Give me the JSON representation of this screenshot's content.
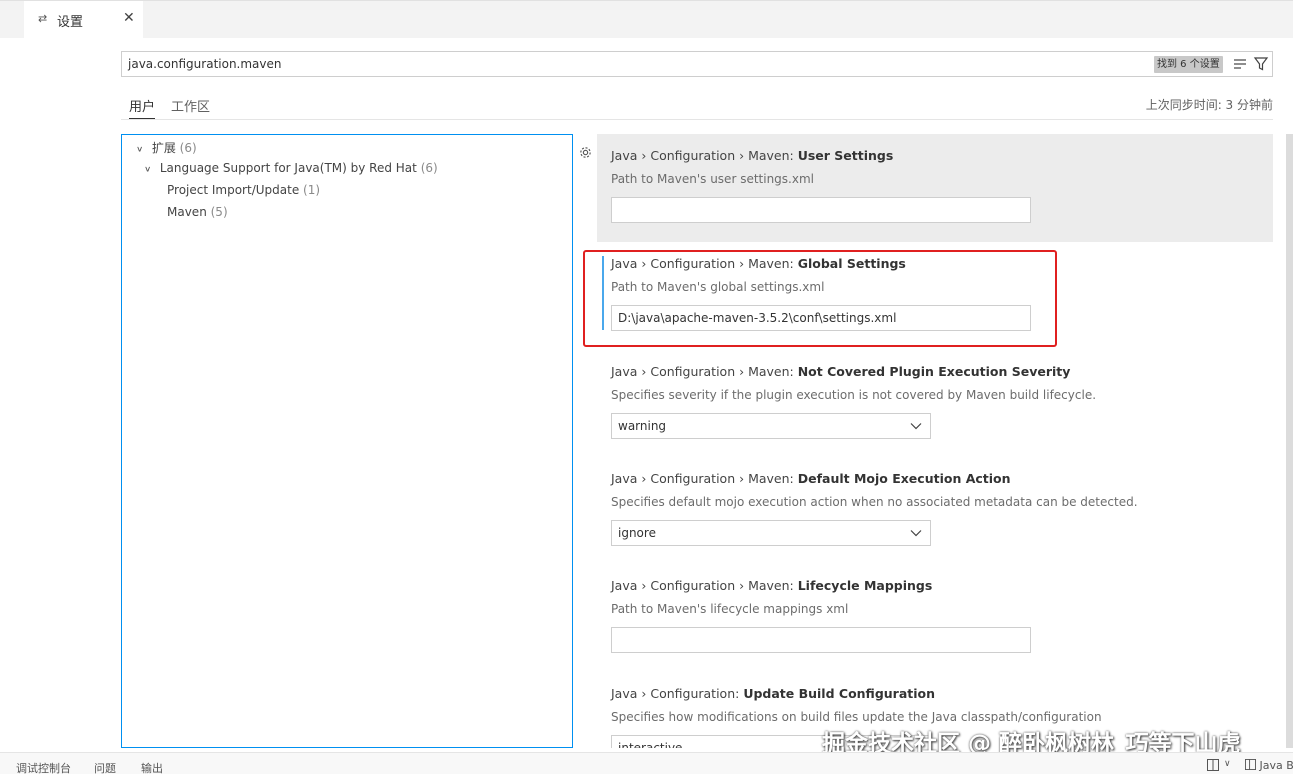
{
  "tab": {
    "icon": "settings-icon",
    "label": "设置",
    "close": "✕"
  },
  "search": {
    "value": "java.configuration.maven",
    "count_badge": "找到 6 个设置"
  },
  "scope": {
    "tabs": [
      "用户",
      "工作区"
    ],
    "sync_text": "上次同步时间: 3 分钟前"
  },
  "toc": {
    "items": [
      {
        "label": "扩展",
        "count": "(6)"
      },
      {
        "label": "Language Support for Java(TM) by Red Hat",
        "count": "(6)"
      },
      {
        "label": "Project Import/Update",
        "count": "(1)"
      },
      {
        "label": "Maven",
        "count": "(5)"
      }
    ]
  },
  "settings": [
    {
      "prefix": "Java › Configuration › Maven: ",
      "name": "User Settings",
      "desc": "Path to Maven's user settings.xml",
      "value": ""
    },
    {
      "prefix": "Java › Configuration › Maven: ",
      "name": "Global Settings",
      "desc": "Path to Maven's global settings.xml",
      "value": "D:\\java\\apache-maven-3.5.2\\conf\\settings.xml"
    },
    {
      "prefix": "Java › Configuration › Maven: ",
      "name": "Not Covered Plugin Execution Severity",
      "desc": "Specifies severity if the plugin execution is not covered by Maven build lifecycle.",
      "value": "warning"
    },
    {
      "prefix": "Java › Configuration › Maven: ",
      "name": "Default Mojo Execution Action",
      "desc": "Specifies default mojo execution action when no associated metadata can be detected.",
      "value": "ignore"
    },
    {
      "prefix": "Java › Configuration › Maven: ",
      "name": "Lifecycle Mappings",
      "desc": "Path to Maven's lifecycle mappings xml",
      "value": ""
    },
    {
      "prefix": "Java › Configuration: ",
      "name": "Update Build Configuration",
      "desc": "Specifies how modifications on build files update the Java classpath/configuration",
      "value": "interactive"
    }
  ],
  "panel": {
    "tabs": [
      "调试控制台",
      "问题",
      "输出"
    ],
    "status_right": "Java B"
  },
  "watermark": "掘金技术社区 @ 醉卧枫树林_巧等下山虎",
  "colors": {
    "highlight": "#e02020",
    "focus_border": "#0090f1",
    "modified_bar": "#4aa8ec"
  }
}
